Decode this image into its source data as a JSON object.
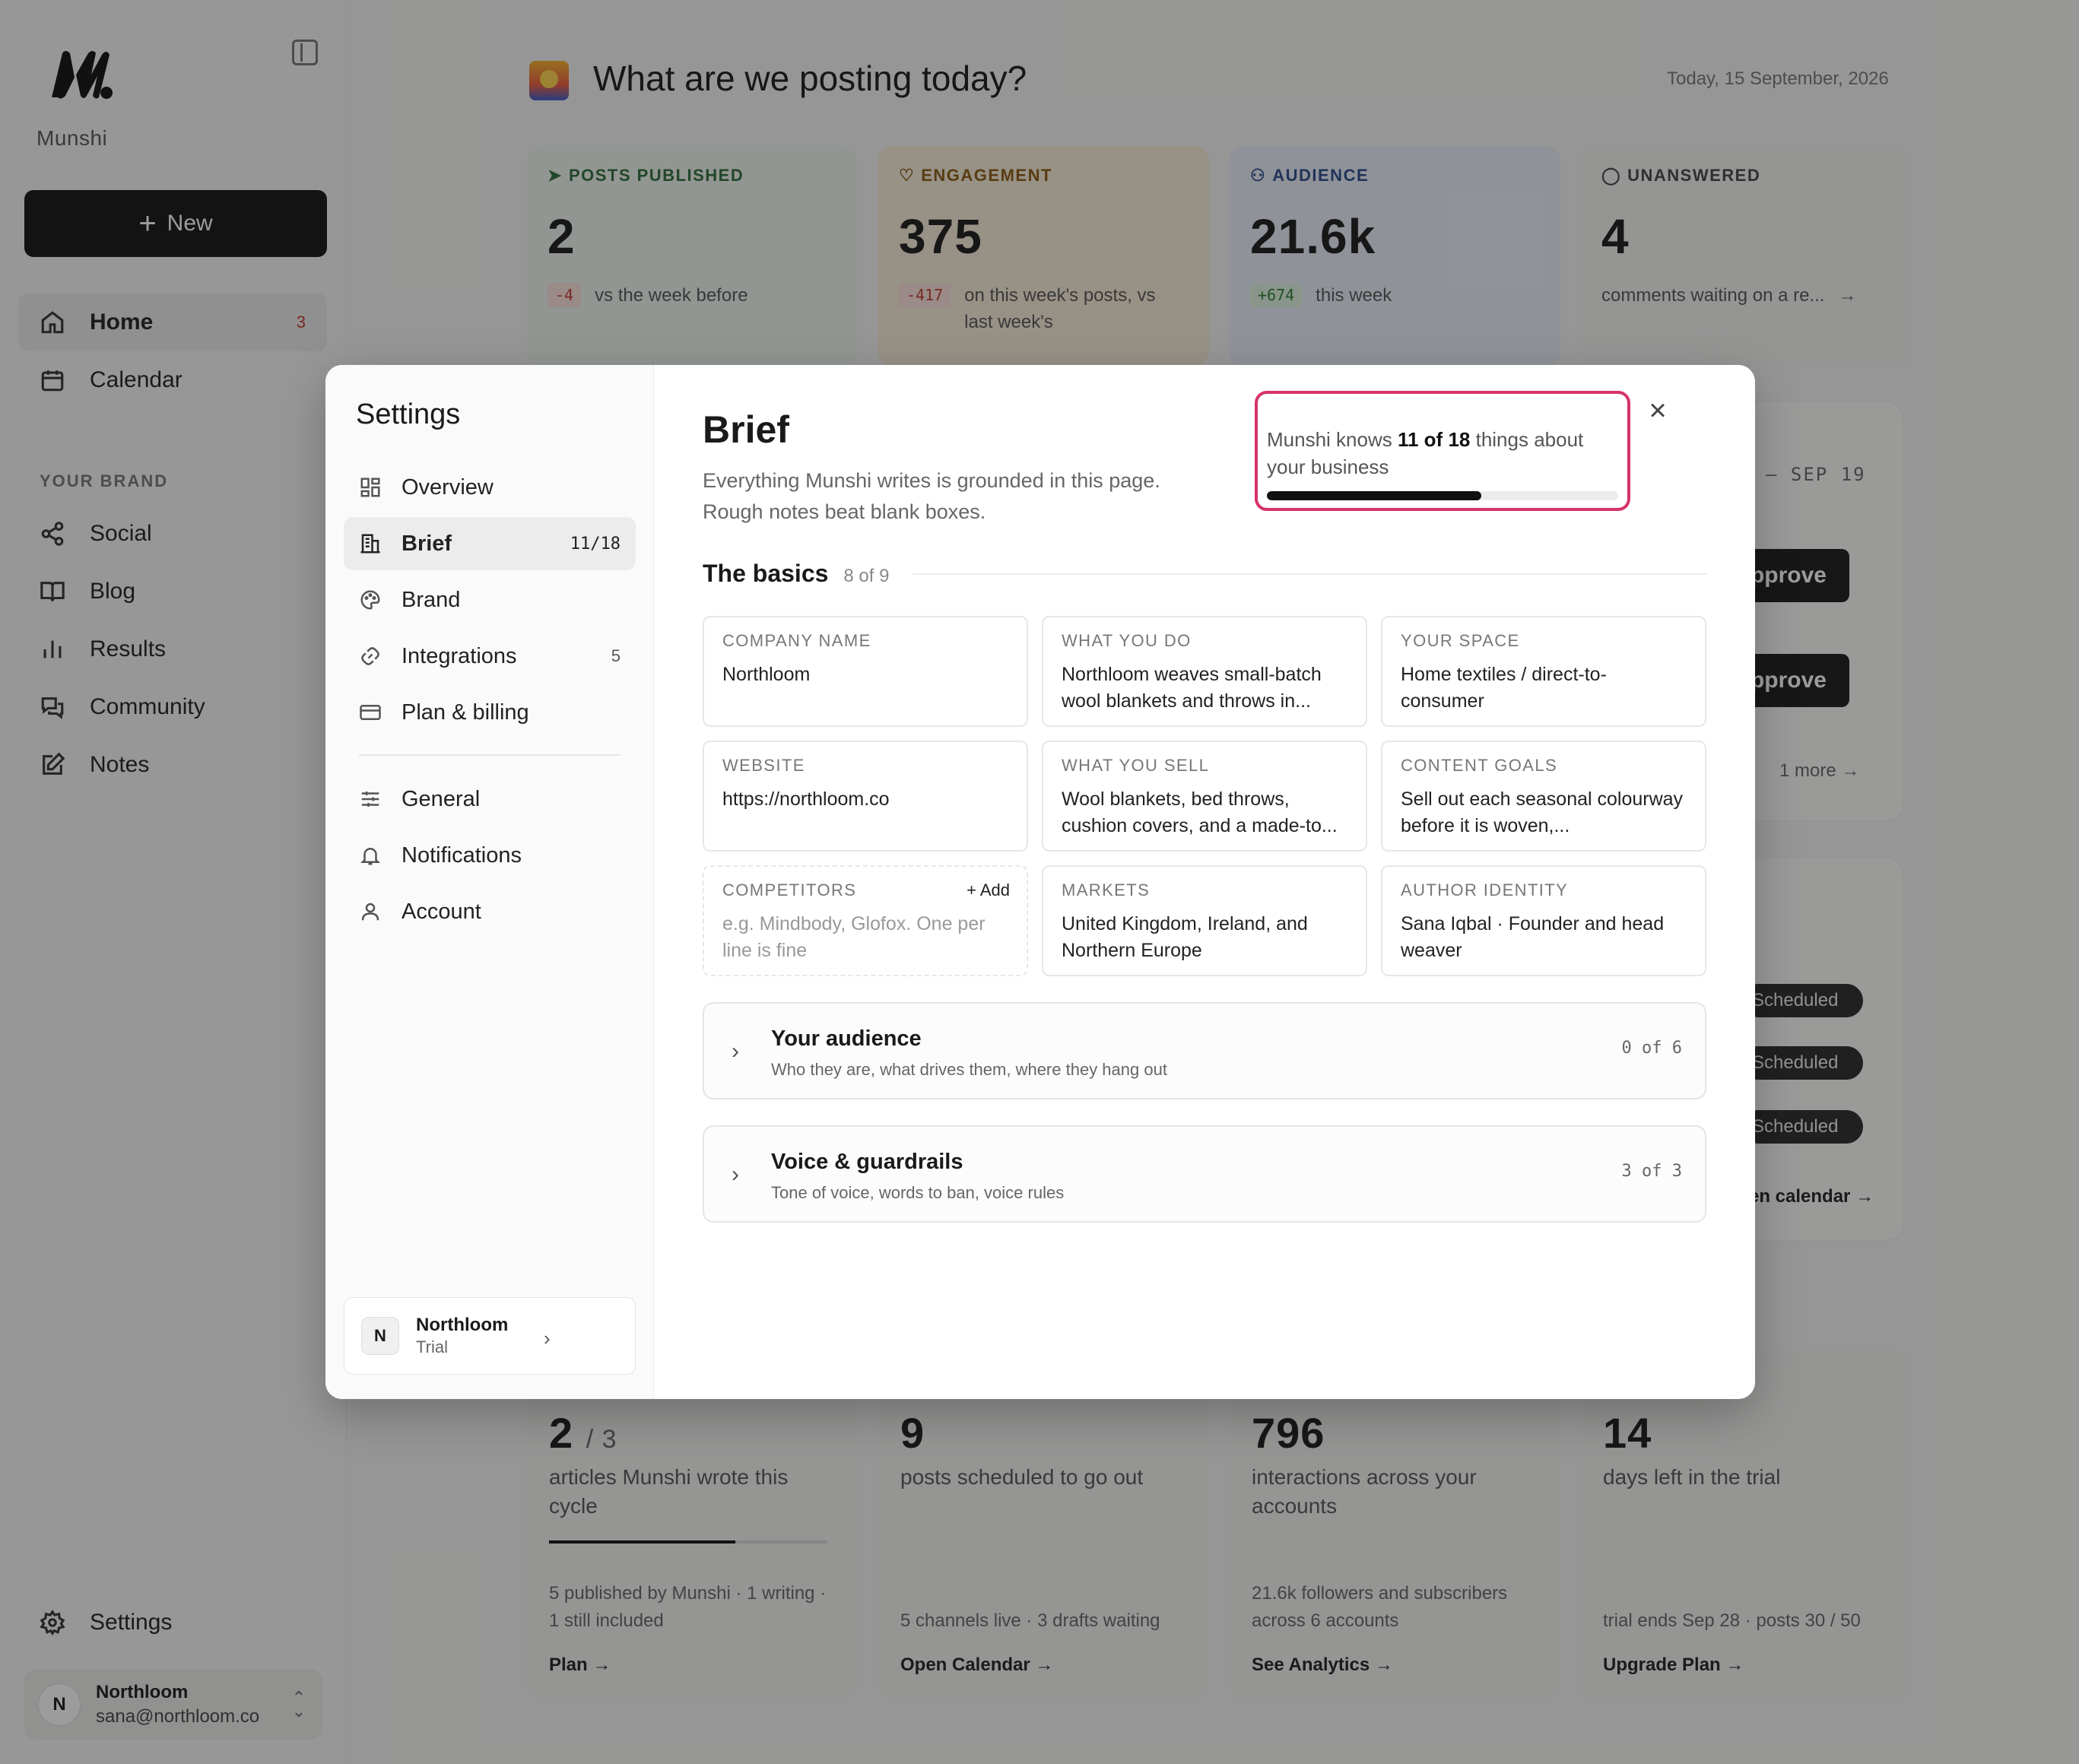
{
  "sidebar": {
    "brand": "Munshi",
    "new_label": "New",
    "items": [
      {
        "label": "Home",
        "badge": "3"
      },
      {
        "label": "Calendar"
      },
      {
        "label": "Social"
      },
      {
        "label": "Blog"
      },
      {
        "label": "Results"
      },
      {
        "label": "Community"
      },
      {
        "label": "Notes"
      }
    ],
    "section_label": "YOUR BRAND",
    "settings_label": "Settings",
    "user": {
      "initial": "N",
      "name": "Northloom",
      "email": "sana@northloom.co"
    }
  },
  "header": {
    "title": "What are we posting today?",
    "date": "Today, 15 September, 2026"
  },
  "stats": [
    {
      "label": "POSTS PUBLISHED",
      "value": "2",
      "delta": "-4",
      "sub": "vs the week before",
      "color": "#2e6b3a",
      "bg": "#eef4ee"
    },
    {
      "label": "ENGAGEMENT",
      "value": "375",
      "delta": "-417",
      "sub": "on this week's posts, vs last week's",
      "color": "#8a5a10",
      "bg": "#f7ecd9"
    },
    {
      "label": "AUDIENCE",
      "value": "21.6k",
      "delta": "+674",
      "sub": "this week",
      "color": "#2c4a8a",
      "bg": "#e9eef8"
    },
    {
      "label": "UNANSWERED",
      "value": "4",
      "sub": "comments waiting on a re...",
      "arrow": "→",
      "color": "#444",
      "bg": "#f3f3f2"
    }
  ],
  "background": {
    "date_range": "– SEP 19",
    "approve_label": "pprove",
    "more_label": "1 more →",
    "scheduled_label": "Scheduled",
    "calendar_link": "en calendar →"
  },
  "bottom_cards": [
    {
      "value": "2",
      "of": "/ 3",
      "desc": "articles Munshi wrote this cycle",
      "foot": "5 published by Munshi · 1 writing · 1 still included",
      "link": "Plan →"
    },
    {
      "value": "9",
      "desc": "posts scheduled to go out",
      "foot": "5 channels live · 3 drafts waiting",
      "link": "Open Calendar →"
    },
    {
      "value": "796",
      "desc": "interactions across your accounts",
      "foot": "21.6k followers and subscribers across 6 accounts",
      "link": "See Analytics →"
    },
    {
      "value": "14",
      "desc": "days left in the trial",
      "foot": "trial ends Sep 28 · posts 30 / 50",
      "link": "Upgrade Plan →"
    }
  ],
  "modal": {
    "title": "Settings",
    "nav": [
      {
        "label": "Overview"
      },
      {
        "label": "Brief",
        "count": "11/18"
      },
      {
        "label": "Brand"
      },
      {
        "label": "Integrations",
        "count": "5"
      },
      {
        "label": "Plan & billing"
      },
      {
        "label": "General"
      },
      {
        "label": "Notifications"
      },
      {
        "label": "Account"
      }
    ],
    "workspace": {
      "initial": "N",
      "name": "Northloom",
      "tier": "Trial"
    },
    "brief": {
      "title": "Brief",
      "subtitle": "Everything Munshi writes is grounded in this page. Rough notes beat blank boxes.",
      "knows_prefix": "Munshi knows ",
      "knows_count": "11 of 18",
      "knows_suffix": " things about your business",
      "progress": 0.61,
      "basics_title": "The basics",
      "basics_count": "8 of 9",
      "fields": [
        {
          "label": "COMPANY NAME",
          "value": "Northloom"
        },
        {
          "label": "WHAT YOU DO",
          "value": "Northloom weaves small-batch wool blankets and throws in..."
        },
        {
          "label": "YOUR SPACE",
          "value": "Home textiles / direct-to-consumer"
        },
        {
          "label": "WEBSITE",
          "value": "https://northloom.co"
        },
        {
          "label": "WHAT YOU SELL",
          "value": "Wool blankets, bed throws, cushion covers, and a made-to..."
        },
        {
          "label": "CONTENT GOALS",
          "value": "Sell out each seasonal colourway before it is woven,..."
        },
        {
          "label": "COMPETITORS",
          "add": "+ Add",
          "placeholder": "e.g. Mindbody, Glofox. One per line is fine"
        },
        {
          "label": "MARKETS",
          "value": "United Kingdom, Ireland, and Northern Europe"
        },
        {
          "label": "AUTHOR IDENTITY",
          "value": "Sana Iqbal · Founder and head weaver"
        }
      ],
      "sections": [
        {
          "title": "Your audience",
          "desc": "Who they are, what drives them, where they hang out",
          "count": "0 of 6"
        },
        {
          "title": "Voice & guardrails",
          "desc": "Tone of voice, words to ban, voice rules",
          "count": "3 of 3"
        }
      ]
    }
  }
}
